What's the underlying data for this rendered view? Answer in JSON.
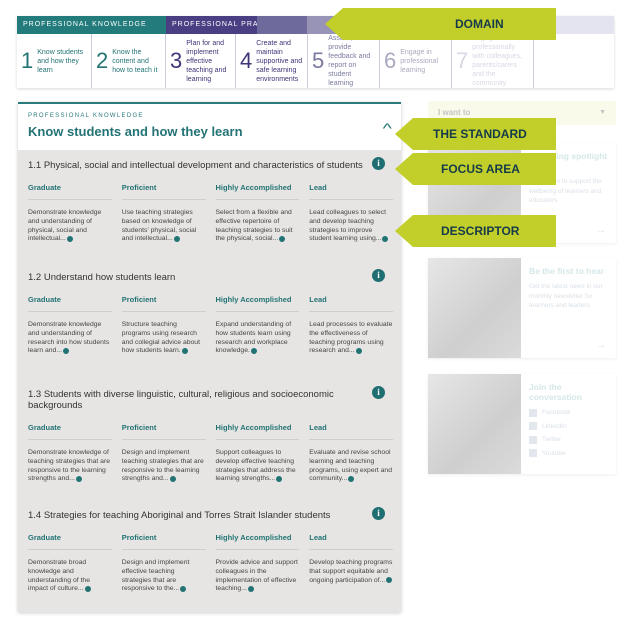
{
  "domains": [
    {
      "label": "PROFESSIONAL KNOWLEDGE",
      "color": "#237b7c"
    },
    {
      "label": "PROFESSIONAL PRACTICE",
      "color": "#4a3f82"
    }
  ],
  "standards": [
    {
      "num": "1",
      "text": "Know students and how they learn",
      "color": "#237375"
    },
    {
      "num": "2",
      "text": "Know the content and how to teach it",
      "color": "#237375"
    },
    {
      "num": "3",
      "text": "Plan for and implement effective teaching and learning",
      "color": "#3d3577"
    },
    {
      "num": "4",
      "text": "Create and maintain supportive and safe learning environments",
      "color": "#3d3577"
    },
    {
      "num": "5",
      "text": "Assess, provide feedback and report on student learning",
      "color": "#7a7aa0"
    },
    {
      "num": "6",
      "text": "Engage in professional learning",
      "color": "#a9a9bf"
    },
    {
      "num": "7",
      "text": "Engage professionally with colleagues, parents/carers and the community",
      "color": "#d8d8e4"
    }
  ],
  "standard": {
    "kicker": "PROFESSIONAL KNOWLEDGE",
    "title": "Know students and how they learn",
    "collapse_icon": "chevron-up-icon"
  },
  "levels": [
    "Graduate",
    "Proficient",
    "Highly Accomplished",
    "Lead"
  ],
  "focus_areas": [
    {
      "title": "1.1 Physical, social and intellectual development and characteristics of students",
      "descriptors": [
        "Demonstrate knowledge and understanding of physical, social and intellectual...",
        "Use teaching strategies based on knowledge of students' physical, social and intellectual...",
        "Select from a flexible and effective repertoire of teaching strategies to suit the physical, social...",
        "Lead colleagues to select and develop teaching strategies to improve student learning using..."
      ]
    },
    {
      "title": "1.2 Understand how students learn",
      "descriptors": [
        "Demonstrate knowledge and understanding of research into how students learn and...",
        "Structure teaching programs using research and collegial advice about how students learn.",
        "Expand understanding of how students learn using research and workplace knowledge.",
        "Lead processes to evaluate the effectiveness of teaching programs using research and..."
      ]
    },
    {
      "title": "1.3 Students with diverse linguistic, cultural, religious and socioeconomic backgrounds",
      "descriptors": [
        "Demonstrate knowledge of teaching strategies that are responsive to the learning strengths and...",
        "Design and implement teaching strategies that are responsive to the learning strengths and...",
        "Support colleagues to develop effective teaching strategies that address the learning strengths...",
        "Evaluate and revise school learning and teaching programs, using expert and community..."
      ]
    },
    {
      "title": "1.4 Strategies for teaching Aboriginal and Torres Strait Islander students",
      "descriptors": [
        "Demonstrate broad knowledge and understanding of the impact of culture...",
        "Design and implement effective teaching strategies that are responsive to the...",
        "Provide advice and support colleagues in the implementation of effective teaching...",
        "Develop teaching programs that support equitable and ongoing participation of..."
      ]
    }
  ],
  "sidebar": {
    "iwant": "I want to",
    "cards": [
      {
        "title": "Wellbeing spotlight report",
        "text": "Resources to support the wellbeing of learners and educators"
      },
      {
        "title": "Be the first to hear",
        "text": "Get the latest news in our monthly newsletter for teachers and leaders"
      },
      {
        "title": "Join the conversation",
        "social": [
          "Facebook",
          "LinkedIn",
          "Twitter",
          "Youtube"
        ]
      }
    ]
  },
  "callouts": [
    "DOMAIN",
    "THE STANDARD",
    "FOCUS AREA",
    "DESCRIPTOR"
  ],
  "accent": "#c2cf2a"
}
